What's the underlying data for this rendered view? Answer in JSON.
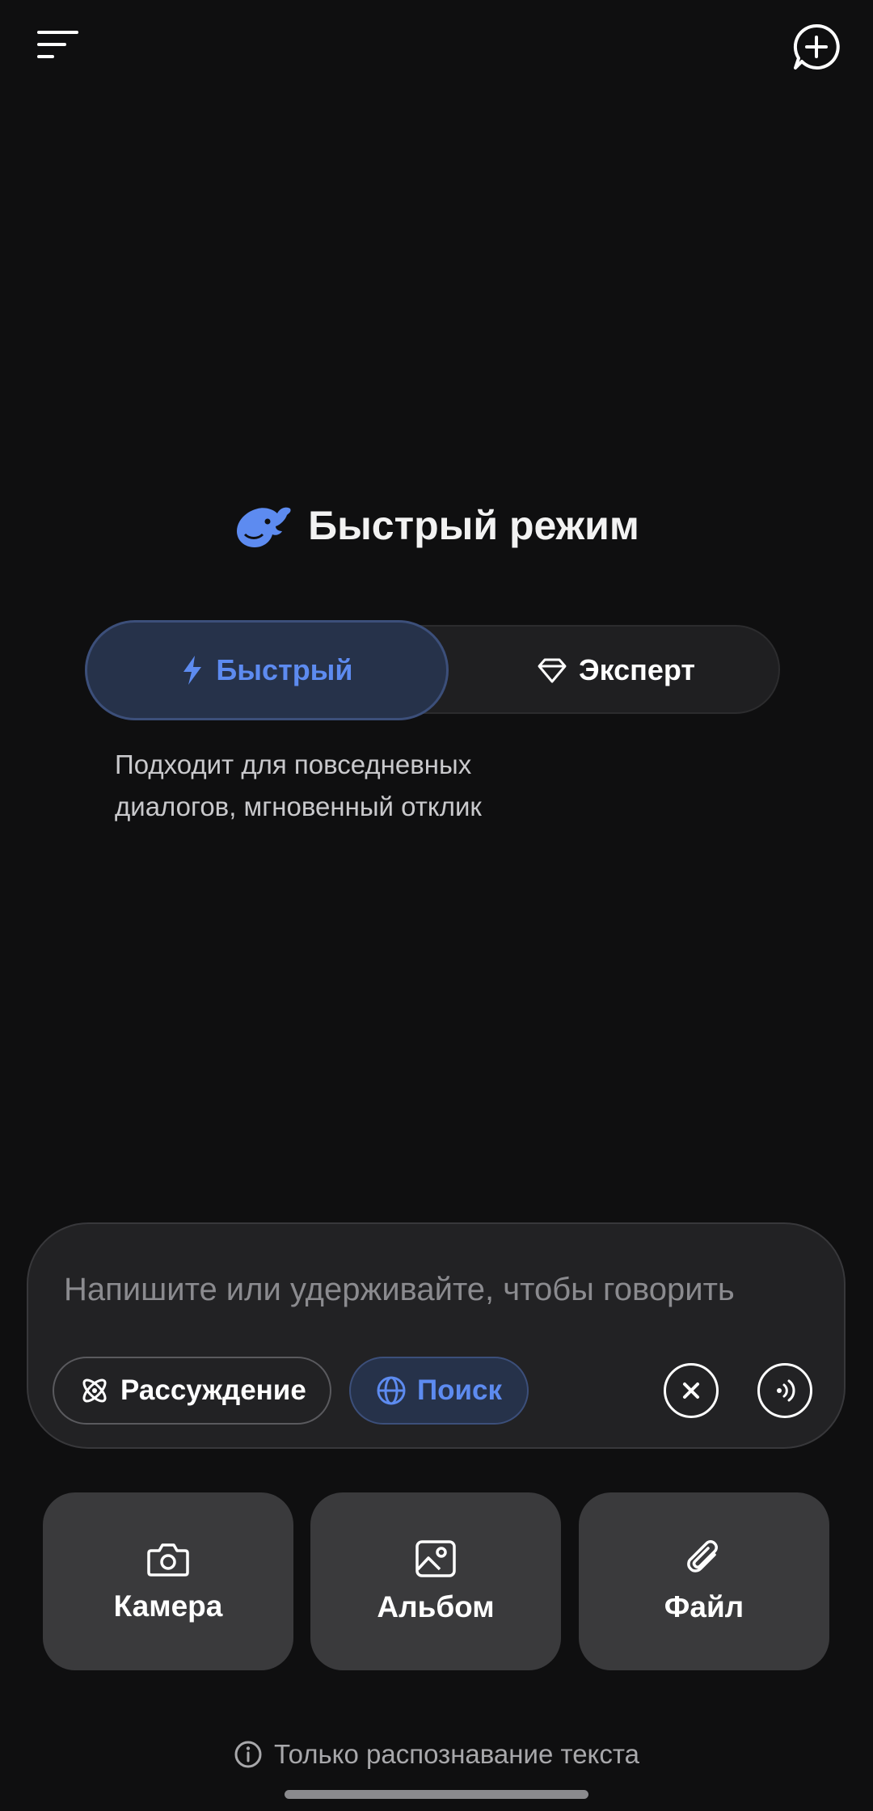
{
  "header": {
    "menu_icon": "menu-icon",
    "new_chat_icon": "new-chat-icon"
  },
  "mode": {
    "logo_icon": "whale-logo-icon",
    "title": "Быстрый режим",
    "options": [
      {
        "label": "Быстрый",
        "icon": "lightning-icon",
        "selected": true
      },
      {
        "label": "Эксперт",
        "icon": "diamond-icon",
        "selected": false
      }
    ],
    "description_line1": "Подходит для повседневных",
    "description_line2": "диалогов, мгновенный отклик"
  },
  "composer": {
    "placeholder": "Напишите или удерживайте, чтобы говорить",
    "value": "",
    "reasoning_label": "Рассуждение",
    "search_label": "Поиск",
    "search_active": true
  },
  "attachments": {
    "camera_label": "Камера",
    "album_label": "Альбом",
    "file_label": "Файл"
  },
  "footer": {
    "note": "Только распознавание текста"
  },
  "colors": {
    "background": "#0f0f10",
    "accent": "#5d8bf0",
    "accent_bg": "#26324a",
    "tile_bg": "#3a3a3c"
  }
}
